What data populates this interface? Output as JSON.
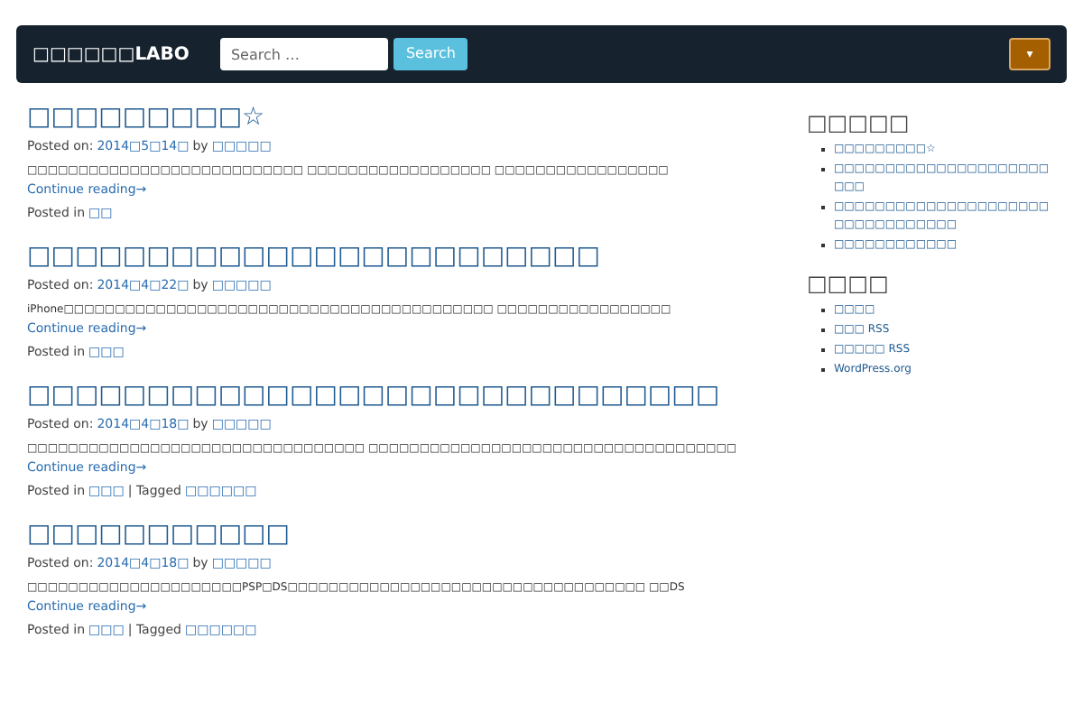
{
  "navbar": {
    "brand": "□□□□□□LABO",
    "search": {
      "placeholder": "Search …"
    },
    "search_button": "Search",
    "menu_caret": "▾"
  },
  "posts": [
    {
      "title": "□□□□□□□□□☆",
      "posted_on": "Posted on:",
      "date": "2014□5□14□",
      "by": "by",
      "author": "□□□□□",
      "excerpt": "□□□□□□□□□□□□□□□□□□□□□□□□□□□ □□□□□□□□□□□□□□□□□□ □□□□□□□□□□□□□□□□□",
      "more": "Continue reading→",
      "posted_in": "Posted in",
      "category": "□□"
    },
    {
      "title": "□□□□□□□□□□□□□□□□□□□□□□□□",
      "posted_on": "Posted on:",
      "date": "2014□4□22□",
      "by": "by",
      "author": "□□□□□",
      "excerpt": "iPhone□□□□□□□□□□□□□□□□□□□□□□□□□□□□□□□□□□□□□□□□□□ □□□□□□□□□□□□□□□□□",
      "more": "Continue reading→",
      "posted_in": "Posted in",
      "category": "□□□"
    },
    {
      "title": "□□□□□□□□□□□□□□□□□□□□□□□□□□□□□",
      "posted_on": "Posted on:",
      "date": "2014□4□18□",
      "by": "by",
      "author": "□□□□□",
      "excerpt": "□□□□□□□□□□□□□□□□□□□□□□□□□□□□□□□□□ □□□□□□□□□□□□□□□□□□□□□□□□□□□□□□□□□□□□",
      "more": "Continue reading→",
      "posted_in": "Posted in",
      "category": "□□□",
      "tagged": "| Tagged",
      "tag": "□□□□□□"
    },
    {
      "title": "□□□□□□□□□□□",
      "posted_on": "Posted on:",
      "date": "2014□4□18□",
      "by": "by",
      "author": "□□□□□",
      "excerpt": "□□□□□□□□□□□□□□□□□□□□□PSP□DS□□□□□□□□□□□□□□□□□□□□□□□□□□□□□□□□□□□ □□DS",
      "more": "Continue reading→",
      "posted_in": "Posted in",
      "category": "□□□",
      "tagged": "| Tagged",
      "tag": "□□□□□□"
    }
  ],
  "sidebar": [
    {
      "heading": "□□□□□",
      "items": [
        "□□□□□□□□□☆",
        "□□□□□□□□□□□□□□□□□□□□□□□□",
        "□□□□□□□□□□□□□□□□□□□□□□□□□□□□□□□□□",
        "□□□□□□□□□□□□"
      ]
    },
    {
      "heading": "□□□□",
      "items": [
        "□□□□",
        "□□□ RSS",
        "□□□□□ RSS",
        "WordPress.org"
      ]
    }
  ]
}
